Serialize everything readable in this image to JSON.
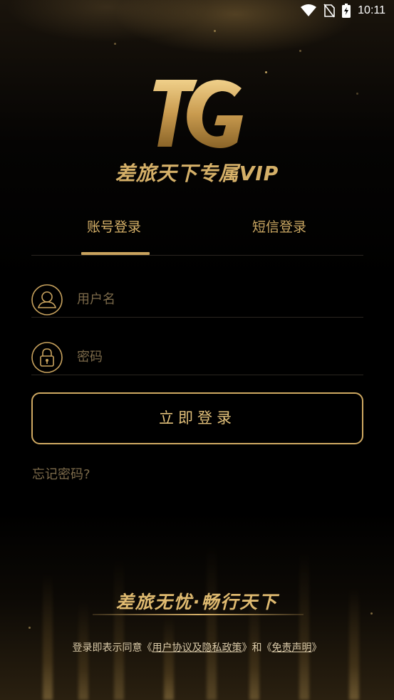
{
  "status_bar": {
    "time": "10:11",
    "icons": [
      "wifi-icon",
      "no-sim-icon",
      "battery-charging-icon"
    ]
  },
  "brand": {
    "logo_text": "TG",
    "tagline": "差旅天下专属VIP"
  },
  "tabs": [
    {
      "label": "账号登录",
      "selected": true
    },
    {
      "label": "短信登录",
      "selected": false
    }
  ],
  "form": {
    "username_placeholder": "用户名",
    "password_placeholder": "密码",
    "login_label": "立即登录",
    "forgot_label": "忘记密码?"
  },
  "footer": {
    "slogan": "差旅无忧·畅行天下",
    "agree_prefix": "登录即表示同意",
    "link1_open": "《",
    "link1": "用户协议及隐私政策",
    "link1_close": "》",
    "and": "和",
    "link2_open": "《",
    "link2": "免责声明",
    "link2_close": "》"
  },
  "colors": {
    "accent_gold": "#d5b068",
    "background": "#000000",
    "placeholder": "#7c6a4a"
  }
}
